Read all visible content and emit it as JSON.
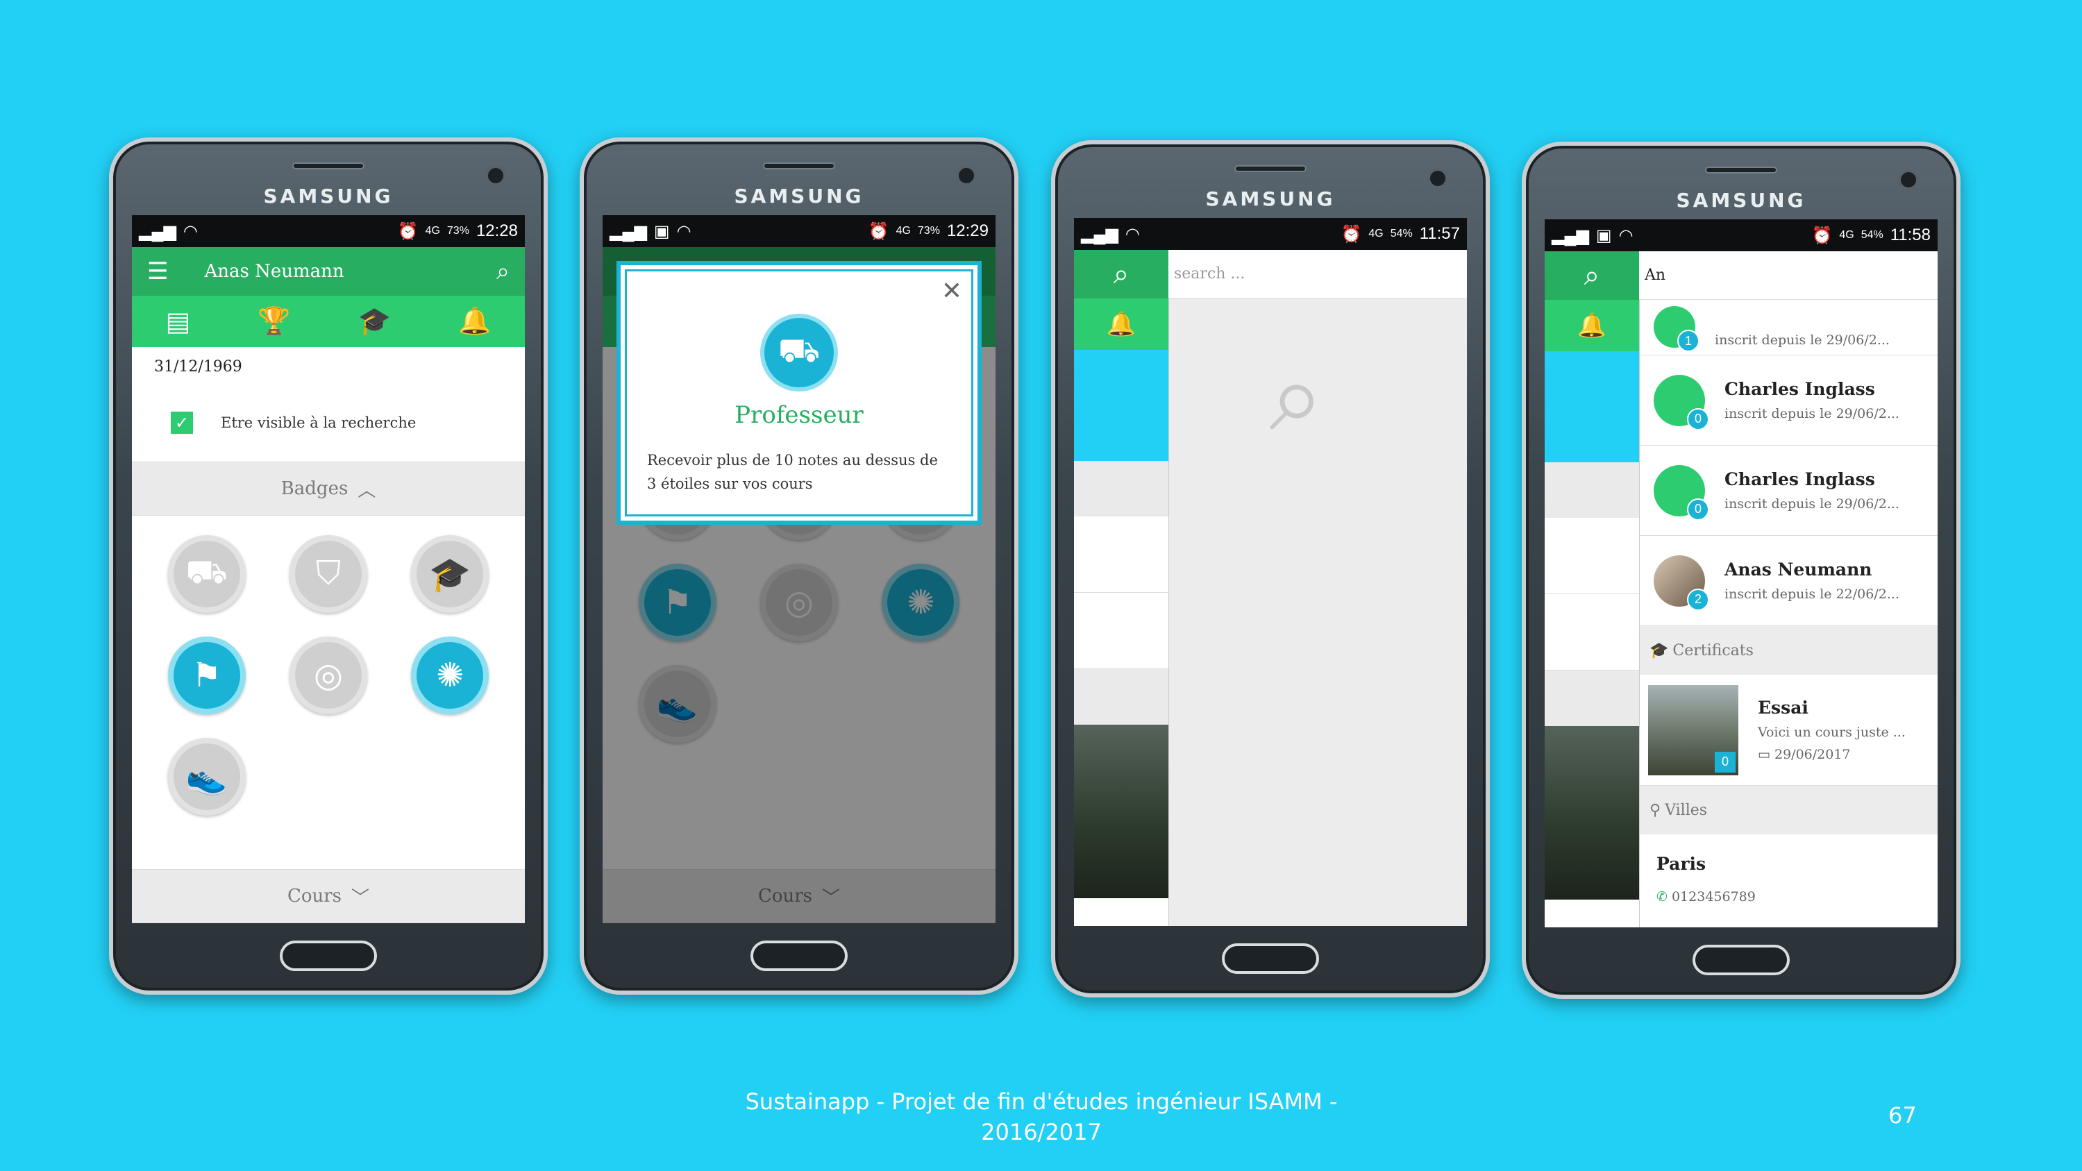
{
  "phones": {
    "brand": "SAMSUNG"
  },
  "screen1": {
    "status_time": "12:28",
    "battery": "73%",
    "network": "4G",
    "title": "Anas Neumann",
    "date": "31/12/1969",
    "checkbox_label": "Etre visible à la recherche",
    "badges_header": "Badges",
    "courses_header": "Cours"
  },
  "screen2": {
    "status_time": "12:29",
    "battery": "73%",
    "network": "4G",
    "dialog_title": "Professeur",
    "dialog_text": "Recevoir plus de 10 notes au dessus de 3 étoiles sur vos cours",
    "courses_header": "Cours"
  },
  "screen3": {
    "status_time": "11:57",
    "battery": "54%",
    "network": "4G",
    "search_placeholder": "search ..."
  },
  "screen4": {
    "status_time": "11:58",
    "battery": "54%",
    "network": "4G",
    "search_value": "An",
    "results": [
      {
        "name": "",
        "sub": "inscrit depuis le 29/06/2...",
        "count": "1"
      },
      {
        "name": "Charles Inglass",
        "sub": "inscrit depuis le 29/06/2...",
        "count": "0"
      },
      {
        "name": "Charles Inglass",
        "sub": "inscrit depuis le 29/06/2...",
        "count": "0"
      },
      {
        "name": "Anas Neumann",
        "sub": "inscrit depuis le 22/06/2...",
        "count": "2"
      }
    ],
    "certificats_header": "Certificats",
    "certificat": {
      "name": "Essai",
      "desc": "Voici un cours juste ...",
      "date": "29/06/2017",
      "count": "0"
    },
    "villes_header": "Villes",
    "ville": {
      "name": "Paris",
      "phone": "0123456789"
    }
  },
  "footer": {
    "line1": "Sustainapp - Projet de fin d'études ingénieur ISAMM -",
    "line2": "2016/2017",
    "page_number": "67"
  },
  "colors": {
    "background": "#22d0f5",
    "green": "#27ae60",
    "accent": "#1ab3d6"
  }
}
